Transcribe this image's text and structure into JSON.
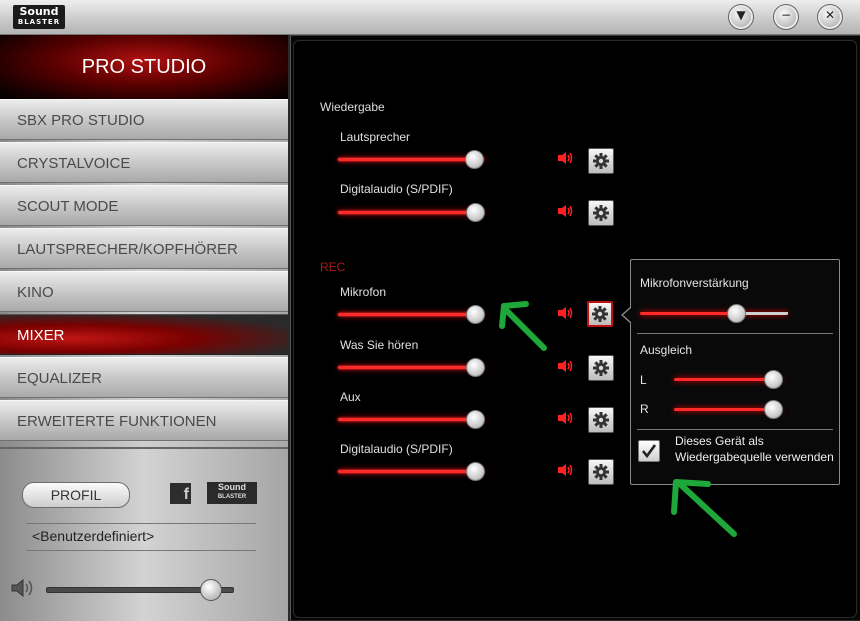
{
  "app": {
    "logo_line1": "Sound",
    "logo_line2": "BLASTER"
  },
  "window_buttons": {
    "down": "▼",
    "minimize": "−",
    "close": "✕"
  },
  "sidebar": {
    "header": "PRO STUDIO",
    "items": [
      {
        "label": "SBX PRO STUDIO"
      },
      {
        "label": "CRYSTALVOICE"
      },
      {
        "label": "SCOUT MODE"
      },
      {
        "label": "LAUTSPRECHER/KOPFHÖRER"
      },
      {
        "label": "KINO"
      },
      {
        "label": "MIXER"
      },
      {
        "label": "EQUALIZER"
      },
      {
        "label": "ERWEITERTE FUNKTIONEN"
      }
    ],
    "active_item": "MIXER",
    "profile_button": "PROFIL",
    "facebook_icon_text": "f",
    "sb_logo_line1": "Sound",
    "sb_logo_line2": "BLASTER",
    "profile_name": "<Benutzerdefiniert>",
    "master_volume": 0.88
  },
  "mixer": {
    "playback_title": "Wiedergabe",
    "playback": [
      {
        "label": "Lautsprecher",
        "level": 0.93
      },
      {
        "label": "Digitalaudio (S/PDIF)",
        "level": 0.94
      }
    ],
    "rec_title": "REC",
    "recording": [
      {
        "label": "Mikrofon",
        "level": 0.94
      },
      {
        "label": "Was Sie hören",
        "level": 0.94
      },
      {
        "label": "Aux",
        "level": 0.94
      },
      {
        "label": "Digitalaudio (S/PDIF)",
        "level": 0.94
      }
    ]
  },
  "popup": {
    "boost_label": "Mikrofonverstärkung",
    "boost_level": 0.65,
    "balance_label": "Ausgleich",
    "left_label": "L",
    "right_label": "R",
    "left_level": 0.92,
    "right_level": 0.92,
    "checkbox_checked": true,
    "checkbox_line1": "Dieses Gerät als",
    "checkbox_line2": "Wiedergabequelle verwenden"
  },
  "colors": {
    "slider_red": "#ff2a2a",
    "active_red": "#c01515",
    "annotation_green": "#1fa83a"
  }
}
